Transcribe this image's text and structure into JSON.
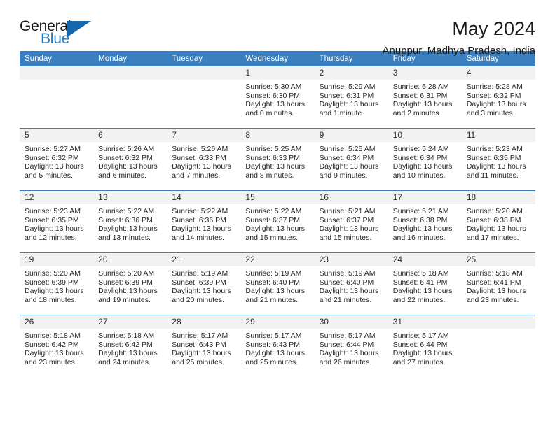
{
  "brand": {
    "name_part1": "General",
    "name_part2": "Blue",
    "primary_color": "#1666ae",
    "accent_color": "#1f7ac4"
  },
  "header": {
    "title": "May 2024",
    "subtitle": "Anuppur, Madhya Pradesh, India"
  },
  "calendar": {
    "header_bg": "#3a7fc0",
    "daynum_bg": "#f2f2f2",
    "weekday_headers": [
      "Sunday",
      "Monday",
      "Tuesday",
      "Wednesday",
      "Thursday",
      "Friday",
      "Saturday"
    ],
    "labels": {
      "sunrise": "Sunrise:",
      "sunset": "Sunset:",
      "daylight": "Daylight:"
    },
    "weeks": [
      [
        {
          "day": "",
          "sunrise": "",
          "sunset": "",
          "daylight": ""
        },
        {
          "day": "",
          "sunrise": "",
          "sunset": "",
          "daylight": ""
        },
        {
          "day": "",
          "sunrise": "",
          "sunset": "",
          "daylight": ""
        },
        {
          "day": "1",
          "sunrise": "Sunrise: 5:30 AM",
          "sunset": "Sunset: 6:30 PM",
          "daylight": "Daylight: 13 hours and 0 minutes."
        },
        {
          "day": "2",
          "sunrise": "Sunrise: 5:29 AM",
          "sunset": "Sunset: 6:31 PM",
          "daylight": "Daylight: 13 hours and 1 minute."
        },
        {
          "day": "3",
          "sunrise": "Sunrise: 5:28 AM",
          "sunset": "Sunset: 6:31 PM",
          "daylight": "Daylight: 13 hours and 2 minutes."
        },
        {
          "day": "4",
          "sunrise": "Sunrise: 5:28 AM",
          "sunset": "Sunset: 6:32 PM",
          "daylight": "Daylight: 13 hours and 3 minutes."
        }
      ],
      [
        {
          "day": "5",
          "sunrise": "Sunrise: 5:27 AM",
          "sunset": "Sunset: 6:32 PM",
          "daylight": "Daylight: 13 hours and 5 minutes."
        },
        {
          "day": "6",
          "sunrise": "Sunrise: 5:26 AM",
          "sunset": "Sunset: 6:32 PM",
          "daylight": "Daylight: 13 hours and 6 minutes."
        },
        {
          "day": "7",
          "sunrise": "Sunrise: 5:26 AM",
          "sunset": "Sunset: 6:33 PM",
          "daylight": "Daylight: 13 hours and 7 minutes."
        },
        {
          "day": "8",
          "sunrise": "Sunrise: 5:25 AM",
          "sunset": "Sunset: 6:33 PM",
          "daylight": "Daylight: 13 hours and 8 minutes."
        },
        {
          "day": "9",
          "sunrise": "Sunrise: 5:25 AM",
          "sunset": "Sunset: 6:34 PM",
          "daylight": "Daylight: 13 hours and 9 minutes."
        },
        {
          "day": "10",
          "sunrise": "Sunrise: 5:24 AM",
          "sunset": "Sunset: 6:34 PM",
          "daylight": "Daylight: 13 hours and 10 minutes."
        },
        {
          "day": "11",
          "sunrise": "Sunrise: 5:23 AM",
          "sunset": "Sunset: 6:35 PM",
          "daylight": "Daylight: 13 hours and 11 minutes."
        }
      ],
      [
        {
          "day": "12",
          "sunrise": "Sunrise: 5:23 AM",
          "sunset": "Sunset: 6:35 PM",
          "daylight": "Daylight: 13 hours and 12 minutes."
        },
        {
          "day": "13",
          "sunrise": "Sunrise: 5:22 AM",
          "sunset": "Sunset: 6:36 PM",
          "daylight": "Daylight: 13 hours and 13 minutes."
        },
        {
          "day": "14",
          "sunrise": "Sunrise: 5:22 AM",
          "sunset": "Sunset: 6:36 PM",
          "daylight": "Daylight: 13 hours and 14 minutes."
        },
        {
          "day": "15",
          "sunrise": "Sunrise: 5:22 AM",
          "sunset": "Sunset: 6:37 PM",
          "daylight": "Daylight: 13 hours and 15 minutes."
        },
        {
          "day": "16",
          "sunrise": "Sunrise: 5:21 AM",
          "sunset": "Sunset: 6:37 PM",
          "daylight": "Daylight: 13 hours and 15 minutes."
        },
        {
          "day": "17",
          "sunrise": "Sunrise: 5:21 AM",
          "sunset": "Sunset: 6:38 PM",
          "daylight": "Daylight: 13 hours and 16 minutes."
        },
        {
          "day": "18",
          "sunrise": "Sunrise: 5:20 AM",
          "sunset": "Sunset: 6:38 PM",
          "daylight": "Daylight: 13 hours and 17 minutes."
        }
      ],
      [
        {
          "day": "19",
          "sunrise": "Sunrise: 5:20 AM",
          "sunset": "Sunset: 6:39 PM",
          "daylight": "Daylight: 13 hours and 18 minutes."
        },
        {
          "day": "20",
          "sunrise": "Sunrise: 5:20 AM",
          "sunset": "Sunset: 6:39 PM",
          "daylight": "Daylight: 13 hours and 19 minutes."
        },
        {
          "day": "21",
          "sunrise": "Sunrise: 5:19 AM",
          "sunset": "Sunset: 6:39 PM",
          "daylight": "Daylight: 13 hours and 20 minutes."
        },
        {
          "day": "22",
          "sunrise": "Sunrise: 5:19 AM",
          "sunset": "Sunset: 6:40 PM",
          "daylight": "Daylight: 13 hours and 21 minutes."
        },
        {
          "day": "23",
          "sunrise": "Sunrise: 5:19 AM",
          "sunset": "Sunset: 6:40 PM",
          "daylight": "Daylight: 13 hours and 21 minutes."
        },
        {
          "day": "24",
          "sunrise": "Sunrise: 5:18 AM",
          "sunset": "Sunset: 6:41 PM",
          "daylight": "Daylight: 13 hours and 22 minutes."
        },
        {
          "day": "25",
          "sunrise": "Sunrise: 5:18 AM",
          "sunset": "Sunset: 6:41 PM",
          "daylight": "Daylight: 13 hours and 23 minutes."
        }
      ],
      [
        {
          "day": "26",
          "sunrise": "Sunrise: 5:18 AM",
          "sunset": "Sunset: 6:42 PM",
          "daylight": "Daylight: 13 hours and 23 minutes."
        },
        {
          "day": "27",
          "sunrise": "Sunrise: 5:18 AM",
          "sunset": "Sunset: 6:42 PM",
          "daylight": "Daylight: 13 hours and 24 minutes."
        },
        {
          "day": "28",
          "sunrise": "Sunrise: 5:17 AM",
          "sunset": "Sunset: 6:43 PM",
          "daylight": "Daylight: 13 hours and 25 minutes."
        },
        {
          "day": "29",
          "sunrise": "Sunrise: 5:17 AM",
          "sunset": "Sunset: 6:43 PM",
          "daylight": "Daylight: 13 hours and 25 minutes."
        },
        {
          "day": "30",
          "sunrise": "Sunrise: 5:17 AM",
          "sunset": "Sunset: 6:44 PM",
          "daylight": "Daylight: 13 hours and 26 minutes."
        },
        {
          "day": "31",
          "sunrise": "Sunrise: 5:17 AM",
          "sunset": "Sunset: 6:44 PM",
          "daylight": "Daylight: 13 hours and 27 minutes."
        },
        {
          "day": "",
          "sunrise": "",
          "sunset": "",
          "daylight": ""
        }
      ]
    ]
  }
}
